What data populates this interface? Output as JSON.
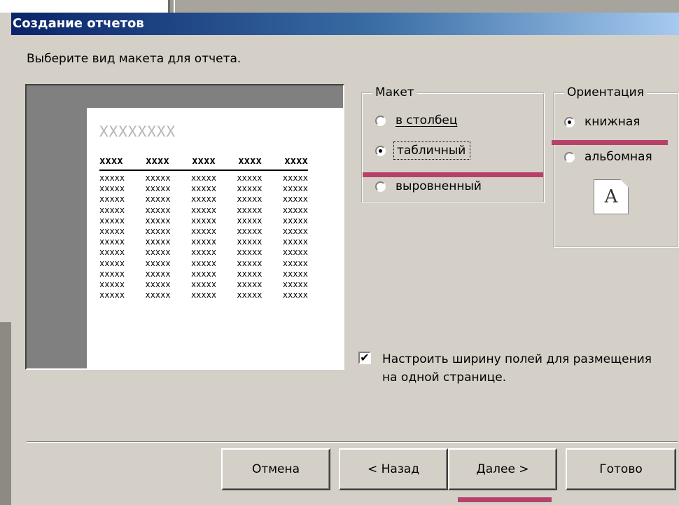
{
  "window": {
    "title": "Создание отчетов"
  },
  "prompt": "Выберите вид макета для отчета.",
  "preview": {
    "title_placeholder": "XXXXXXXX",
    "header_cells": [
      "xxxx",
      "xxxx",
      "xxxx",
      "xxxx",
      "xxxx"
    ],
    "row_cell": "xxxxx",
    "row_count": 12,
    "col_count": 5
  },
  "layout_group": {
    "legend": "Макет",
    "options": [
      {
        "label": "в столбец",
        "checked": false
      },
      {
        "label": "табличный",
        "checked": true
      },
      {
        "label": "выровненный",
        "checked": false
      }
    ]
  },
  "orientation_group": {
    "legend": "Ориентация",
    "options": [
      {
        "label": "книжная",
        "checked": true
      },
      {
        "label": "альбомная",
        "checked": false
      }
    ],
    "icon_letter": "A"
  },
  "fit_checkbox": {
    "checked": true,
    "check_glyph": "✔",
    "label": "Настроить ширину полей для размещения на одной странице."
  },
  "buttons": {
    "cancel": "Отмена",
    "back": "< Назад",
    "next": "Далее >",
    "finish": "Готово"
  },
  "colors": {
    "highlight": "#b8416a",
    "titlebar_start": "#0a246a",
    "titlebar_end": "#a6caf0",
    "dialog_bg": "#d4d0c8"
  }
}
